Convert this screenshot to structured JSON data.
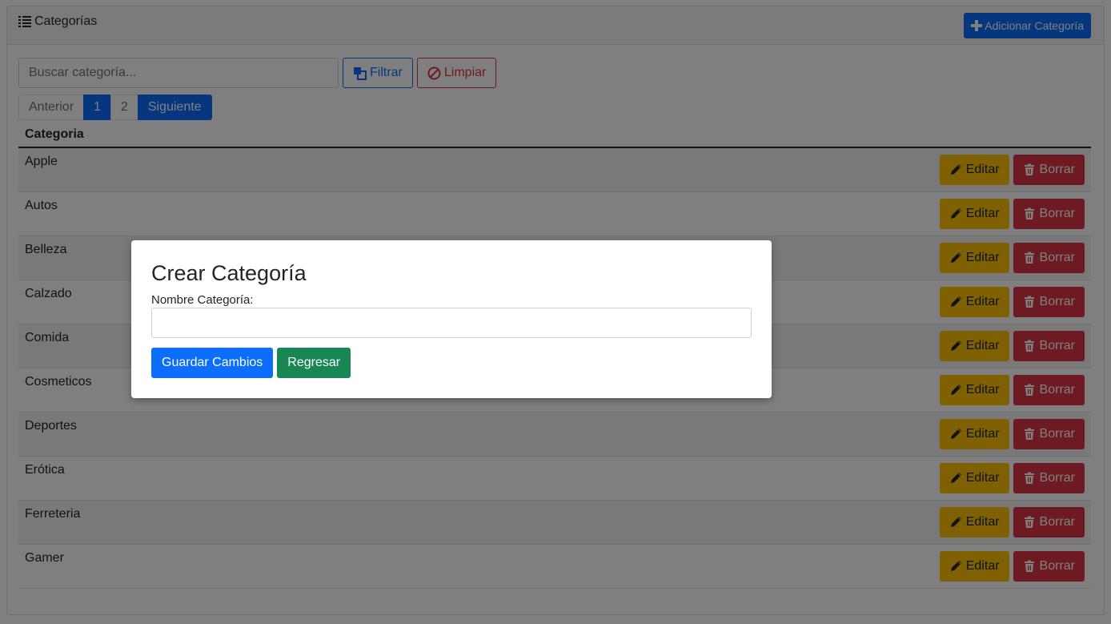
{
  "header": {
    "title": "Categorías",
    "title_icon": "list-icon",
    "add_button_label": "Adicionar Categoría",
    "add_button_icon": "plus-icon"
  },
  "search": {
    "placeholder": "Buscar categoría...",
    "value": "",
    "filter_label": "Filtrar",
    "filter_icon": "filter-icon",
    "clear_label": "Limpiar",
    "clear_icon": "ban-icon"
  },
  "pagination": {
    "previous_label": "Anterior",
    "pages": [
      "1",
      "2"
    ],
    "active_page": "1",
    "next_label": "Siguiente"
  },
  "table": {
    "column_header": "Categoria",
    "edit_label": "Editar",
    "delete_label": "Borrar",
    "rows": [
      "Apple",
      "Autos",
      "Belleza",
      "Calzado",
      "Comida",
      "Cosmeticos",
      "Deportes",
      "Erótica",
      "Ferreteria",
      "Gamer"
    ]
  },
  "modal": {
    "title": "Crear Categoría",
    "field_label": "Nombre Categoría:",
    "field_value": "",
    "save_label": "Guardar Cambios",
    "back_label": "Regresar"
  },
  "colors": {
    "primary": "#0d6efd",
    "danger": "#dc3545",
    "warning": "#ffc107",
    "success": "#198754"
  }
}
